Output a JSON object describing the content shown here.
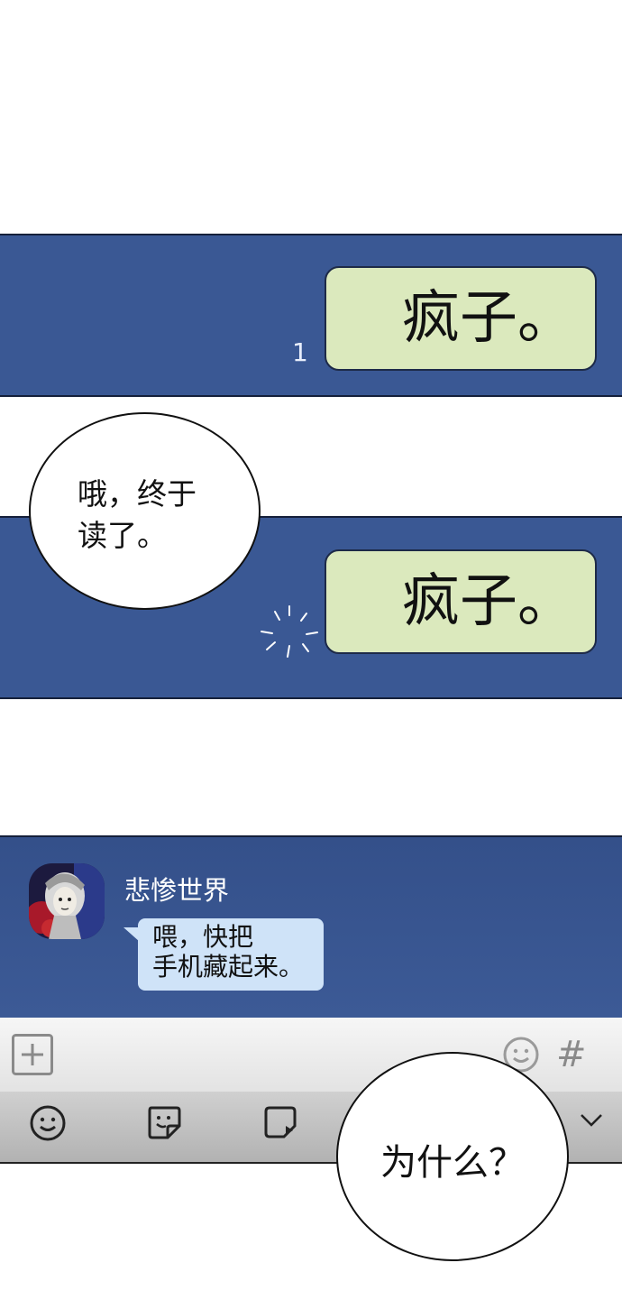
{
  "panel1": {
    "message": "疯子。",
    "read_count": "1"
  },
  "speech1": {
    "line1": "哦，终于",
    "line2": "读了。"
  },
  "panel2": {
    "message": "疯子。"
  },
  "chat": {
    "sender_name": "悲惨世界",
    "message_line1": "喂，快把",
    "message_line2": "手机藏起来。"
  },
  "input_bar": {
    "hash_label": "#"
  },
  "toolbar": {
    "icons": [
      "smile-icon",
      "sticker-icon",
      "video-note-icon",
      "chevron-down-icon"
    ]
  },
  "speech2": {
    "text": "为什么？"
  }
}
